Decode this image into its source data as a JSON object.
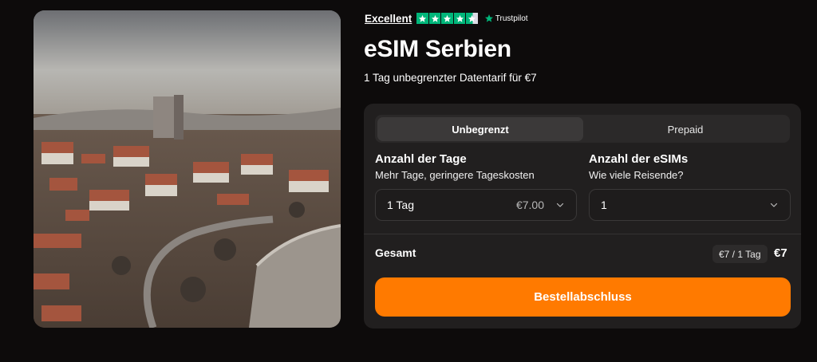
{
  "trustpilot": {
    "rating_label": "Excellent",
    "stars": 4.5,
    "brand": "Trustpilot",
    "color": "#00b67a"
  },
  "product": {
    "title": "eSIM Serbien",
    "subtitle": "1 Tag unbegrenzter Datentarif für €7"
  },
  "tabs": [
    {
      "label": "Unbegrenzt",
      "active": true
    },
    {
      "label": "Prepaid",
      "active": false
    }
  ],
  "days": {
    "title": "Anzahl der Tage",
    "subtitle": "Mehr Tage, geringere Tageskosten",
    "selected": "1 Tag",
    "price": "€7.00"
  },
  "esims": {
    "title": "Anzahl der eSIMs",
    "subtitle": "Wie viele Reisende?",
    "selected": "1"
  },
  "total": {
    "label": "Gesamt",
    "per_day": "€7 / 1 Tag",
    "price": "€7"
  },
  "checkout": {
    "label": "Bestellabschluss",
    "color": "#ff7a00"
  },
  "image": {
    "description_icon": "city-landscape-photo"
  }
}
